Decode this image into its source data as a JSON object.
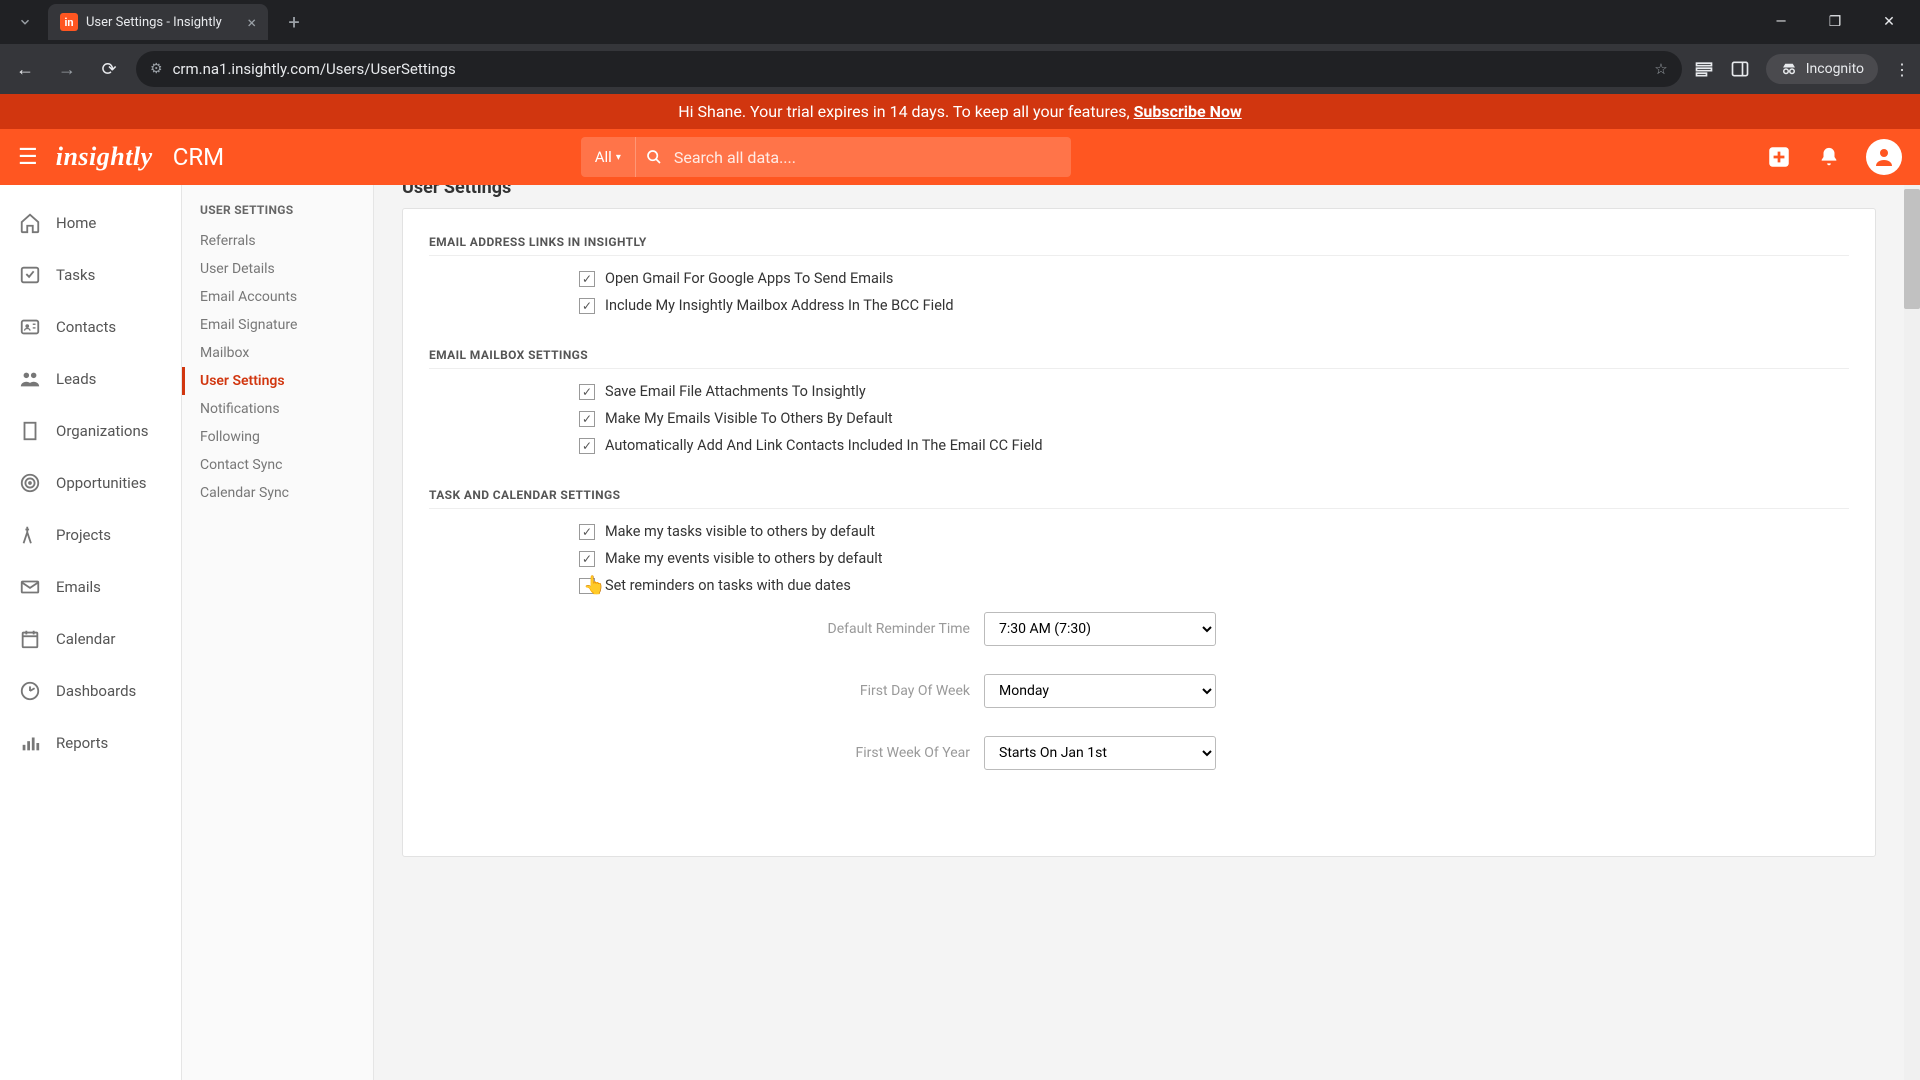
{
  "browser": {
    "tab_title": "User Settings - Insightly",
    "url": "crm.na1.insightly.com/Users/UserSettings",
    "incognito_label": "Incognito"
  },
  "banner": {
    "greeting": "Hi Shane. Your trial expires in 14 days. To keep all your features, ",
    "cta": "Subscribe Now"
  },
  "header": {
    "logo_text": "insightly",
    "app_name": "CRM",
    "search_scope": "All",
    "search_placeholder": "Search all data...."
  },
  "left_nav": [
    {
      "label": "Home"
    },
    {
      "label": "Tasks"
    },
    {
      "label": "Contacts"
    },
    {
      "label": "Leads"
    },
    {
      "label": "Organizations"
    },
    {
      "label": "Opportunities"
    },
    {
      "label": "Projects"
    },
    {
      "label": "Emails"
    },
    {
      "label": "Calendar"
    },
    {
      "label": "Dashboards"
    },
    {
      "label": "Reports"
    }
  ],
  "sub_nav": {
    "title": "USER SETTINGS",
    "items": [
      {
        "label": "Referrals"
      },
      {
        "label": "User Details"
      },
      {
        "label": "Email Accounts"
      },
      {
        "label": "Email Signature"
      },
      {
        "label": "Mailbox"
      },
      {
        "label": "User Settings",
        "active": true
      },
      {
        "label": "Notifications"
      },
      {
        "label": "Following"
      },
      {
        "label": "Contact Sync"
      },
      {
        "label": "Calendar Sync"
      }
    ]
  },
  "page": {
    "title": "User Settings",
    "sections": {
      "email_links": {
        "title": "EMAIL ADDRESS LINKS IN INSIGHTLY",
        "opt1": "Open Gmail For Google Apps To Send Emails",
        "opt2": "Include My Insightly Mailbox Address In The BCC Field"
      },
      "mailbox": {
        "title": "EMAIL MAILBOX SETTINGS",
        "opt1": "Save Email File Attachments To Insightly",
        "opt2": "Make My Emails Visible To Others By Default",
        "opt3": "Automatically Add And Link Contacts Included In The Email CC Field"
      },
      "task_cal": {
        "title": "TASK AND CALENDAR SETTINGS",
        "opt1": "Make my tasks visible to others by default",
        "opt2": "Make my events visible to others by default",
        "opt3": "Set reminders on tasks with due dates",
        "reminder_label": "Default Reminder Time",
        "reminder_value": "7:30 AM (7:30)",
        "first_day_label": "First Day Of Week",
        "first_day_value": "Monday",
        "first_week_label": "First Week Of Year",
        "first_week_value": "Starts On Jan 1st"
      }
    }
  }
}
